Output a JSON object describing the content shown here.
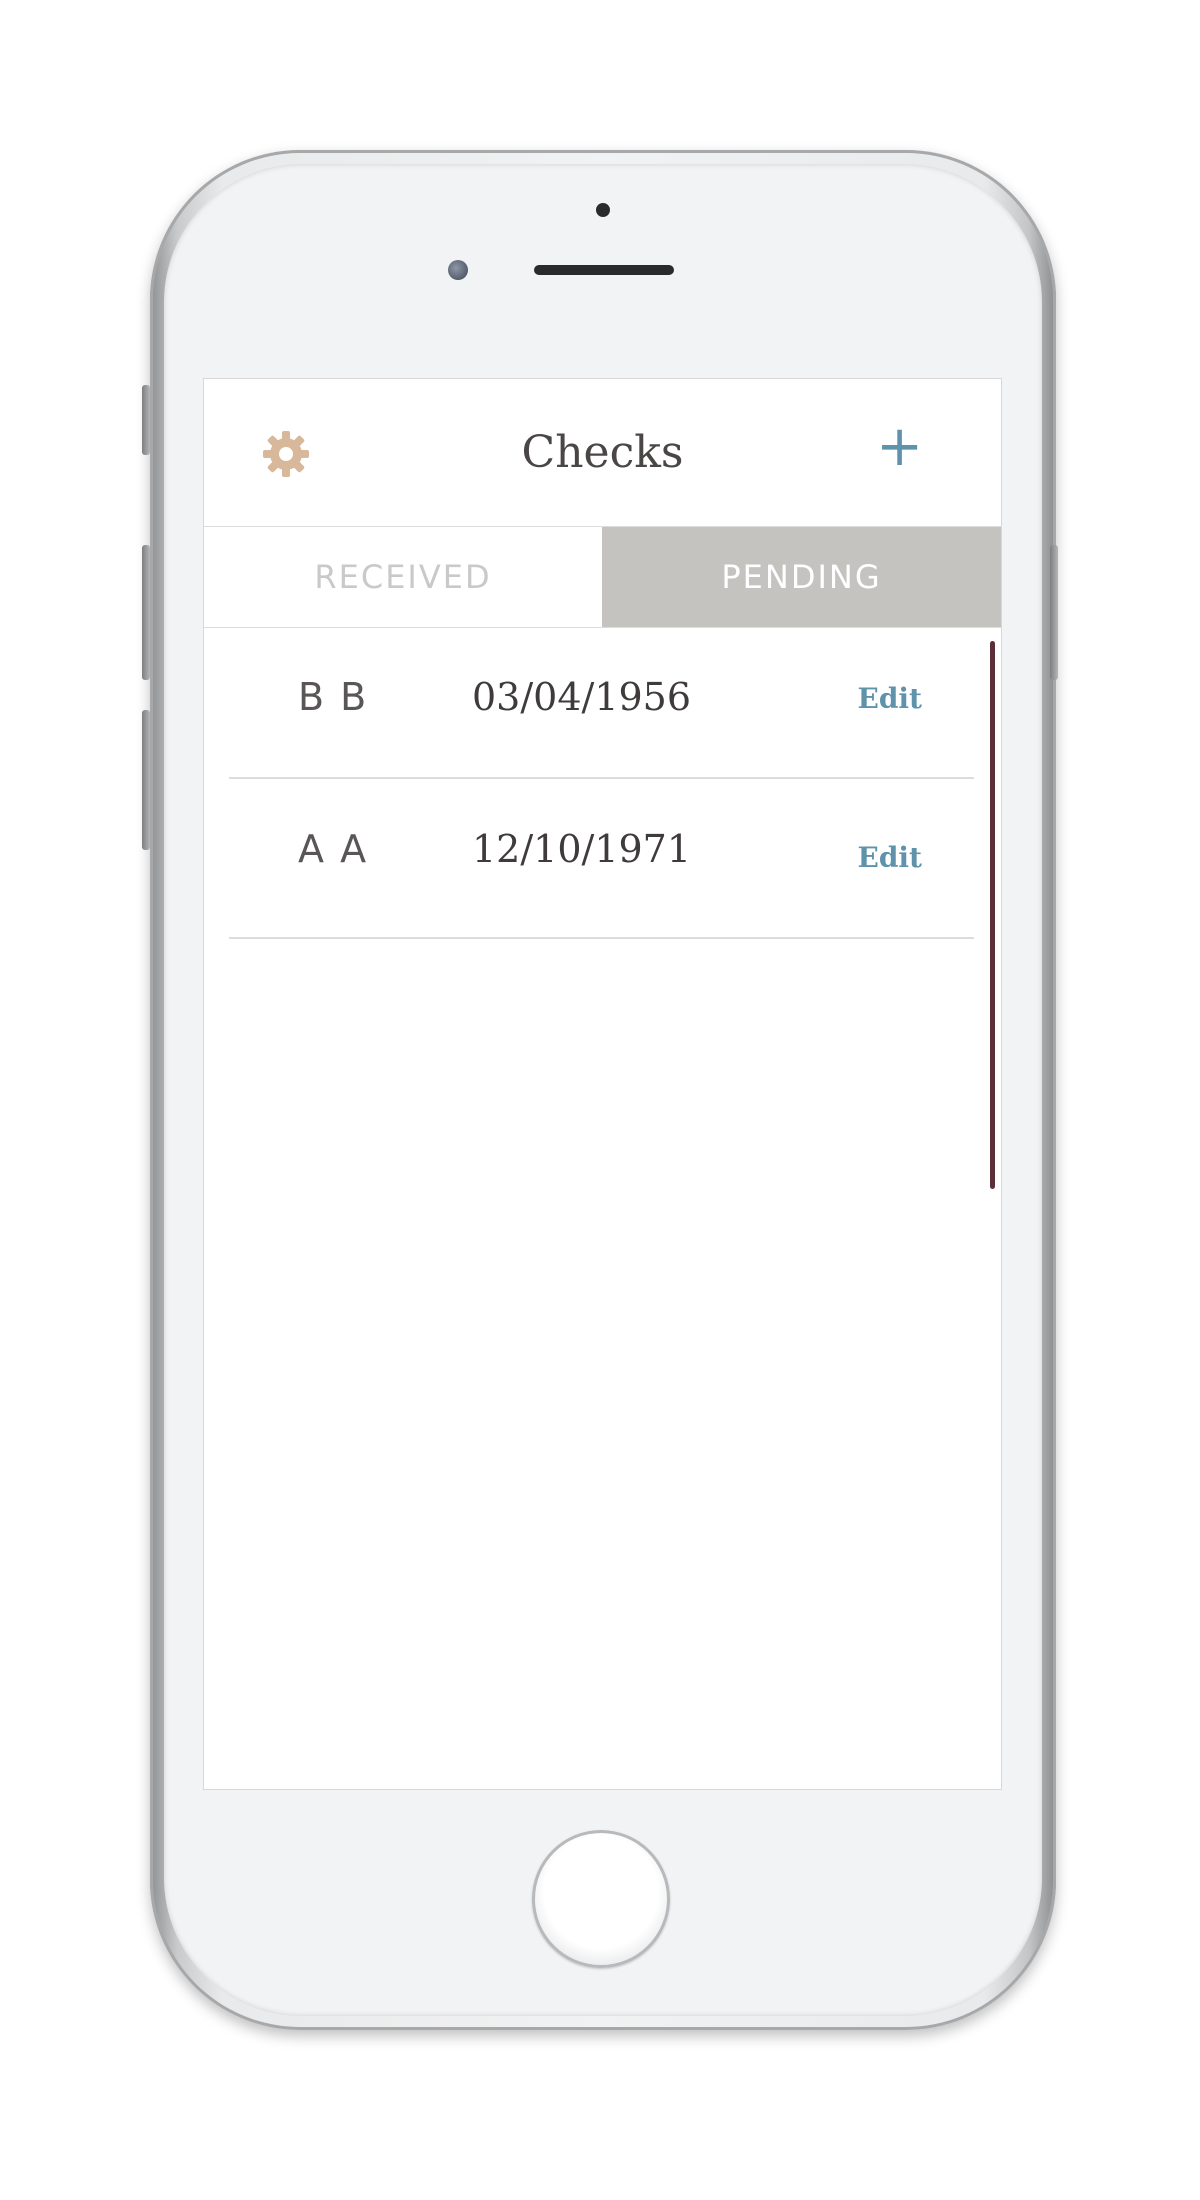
{
  "app": {
    "title": "Checks",
    "add_label": "+"
  },
  "tabs": [
    {
      "label": "RECEIVED",
      "selected": false
    },
    {
      "label": "PENDING",
      "selected": true
    }
  ],
  "checks": [
    {
      "initials": "B B",
      "date": "03/04/1956",
      "edit_label": "Edit"
    },
    {
      "initials": "A A",
      "date": "12/10/1971",
      "edit_label": "Edit"
    }
  ],
  "colors": {
    "accent": "#5f93ab",
    "gear": "#d7b89a",
    "tab_selected_bg": "#c5c3c0",
    "scroll_indicator": "#5c2f38"
  },
  "icons": {
    "settings": "gear-icon",
    "add": "plus-icon"
  }
}
